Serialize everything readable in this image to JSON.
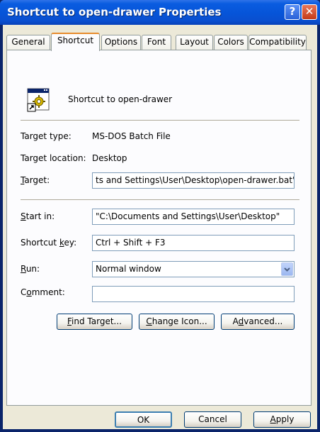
{
  "window": {
    "title": "Shortcut to open-drawer Properties"
  },
  "tabs": [
    "General",
    "Shortcut",
    "Options",
    "Font",
    "Layout",
    "Colors",
    "Compatibility"
  ],
  "header": {
    "name": "Shortcut to open-drawer"
  },
  "info": {
    "type_label": "Target type:",
    "type_value": "MS-DOS Batch File",
    "location_label": "Target location:",
    "location_value": "Desktop"
  },
  "fields": {
    "target_label_pre": "",
    "target_label_key": "T",
    "target_label_post": "arget:",
    "target_value": "ts and Settings\\User\\Desktop\\open-drawer.bat\"",
    "startin_label_key": "S",
    "startin_label_post": "tart in:",
    "startin_value": "\"C:\\Documents and Settings\\User\\Desktop\"",
    "shortcut_label_pre": "Shortcut ",
    "shortcut_label_key": "k",
    "shortcut_label_post": "ey:",
    "shortcut_value": "Ctrl + Shift + F3",
    "run_label_key": "R",
    "run_label_post": "un:",
    "run_value": "Normal window",
    "comment_label_pre": "C",
    "comment_label_key": "o",
    "comment_label_post": "mment:",
    "comment_value": ""
  },
  "buttons": {
    "find_key": "F",
    "find_post": "ind Target...",
    "change_key": "C",
    "change_post": "hange Icon...",
    "advanced_pre": "A",
    "advanced_key": "d",
    "advanced_post": "vanced...",
    "ok": "OK",
    "cancel": "Cancel",
    "apply_key": "A",
    "apply_post": "pply"
  },
  "titlebar_buttons": {
    "help": "?",
    "close": "✕"
  }
}
